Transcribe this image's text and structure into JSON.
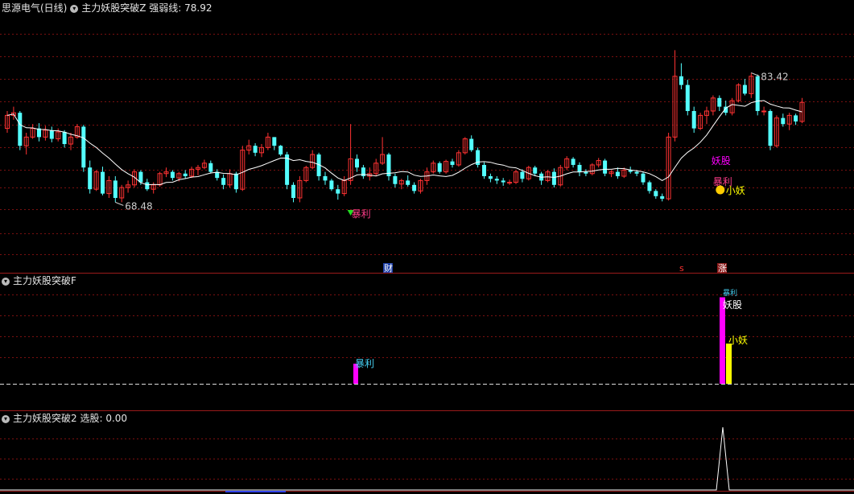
{
  "panel1": {
    "stock_name": "思源电气(日线)",
    "indicator": "主力妖股突破Z",
    "line_label": "强弱线",
    "line_value": "78.92"
  },
  "panel2": {
    "indicator": "主力妖股突破F"
  },
  "panel3": {
    "indicator": "主力妖股突破2",
    "line_label": "选股",
    "line_value": "0.00"
  },
  "colors": {
    "up": "#ff3232",
    "down": "#54ffff",
    "ma": "#ffffff",
    "grid": "#7a1010",
    "magenta": "#ff00ff",
    "yellow": "#ffff00",
    "signal_text": "#ff3d8a"
  },
  "chart_data": [
    {
      "type": "candlestick",
      "title": "思源电气(日线)",
      "ylim": [
        64,
        89
      ],
      "annotations": {
        "high": "83.42",
        "low": "68.48",
        "signal_baoli_1": "暴利",
        "signal_yaogu": "妖股",
        "signal_baoli_2": "暴利",
        "signal_xiaoyao": "小妖",
        "marker_cai": "财",
        "marker_s": "s",
        "marker_zhang": "涨"
      },
      "ohlc": [
        [
          77,
          79,
          76.5,
          78.5
        ],
        [
          78.5,
          79.5,
          78,
          78.8
        ],
        [
          78.8,
          79,
          74.5,
          75
        ],
        [
          75,
          76.5,
          74,
          76
        ],
        [
          76,
          77.5,
          75.8,
          77
        ],
        [
          77,
          77.6,
          75.5,
          76
        ],
        [
          76,
          77.3,
          75.6,
          76.8
        ],
        [
          76.8,
          77.2,
          75.4,
          75.8
        ],
        [
          75.8,
          77,
          75.5,
          76.6
        ],
        [
          76.6,
          76.8,
          74.8,
          75.2
        ],
        [
          75.2,
          76.5,
          74.5,
          76
        ],
        [
          76,
          77.5,
          75.8,
          77.2
        ],
        [
          77.2,
          77.4,
          72,
          72.5
        ],
        [
          72.5,
          73.3,
          69.5,
          70
        ],
        [
          70,
          72.2,
          69.8,
          72
        ],
        [
          72,
          72.6,
          69.3,
          69.5
        ],
        [
          69.5,
          71.5,
          69,
          71
        ],
        [
          71,
          71.5,
          68.5,
          69
        ],
        [
          69,
          70.5,
          68.5,
          70.2
        ],
        [
          70.2,
          71,
          69.6,
          70.5
        ],
        [
          70.5,
          72.3,
          70.2,
          72
        ],
        [
          72,
          72.2,
          70.5,
          70.8
        ],
        [
          70.8,
          71.2,
          69.8,
          70
        ],
        [
          70,
          70.8,
          69.5,
          70.5
        ],
        [
          70.5,
          72,
          70.3,
          71.8
        ],
        [
          71.8,
          72.5,
          71.4,
          72
        ],
        [
          72,
          72.2,
          71,
          71.3
        ],
        [
          71.3,
          72,
          70.9,
          71.8
        ],
        [
          71.8,
          72.2,
          71.2,
          71.5
        ],
        [
          71.5,
          72.6,
          71.3,
          72.3
        ],
        [
          72.3,
          72.8,
          71.6,
          72.5
        ],
        [
          72.5,
          73.4,
          72.3,
          73
        ],
        [
          73,
          73.3,
          71.8,
          72
        ],
        [
          72,
          72.3,
          71,
          71.3
        ],
        [
          71.3,
          71.7,
          70,
          70.5
        ],
        [
          70.5,
          72.3,
          70.2,
          71.8
        ],
        [
          71.8,
          72,
          69.6,
          70
        ],
        [
          70,
          75,
          69.8,
          74.5
        ],
        [
          74.5,
          75.7,
          74,
          75
        ],
        [
          75,
          75.3,
          73.8,
          74.2
        ],
        [
          74.2,
          75.2,
          73.7,
          74.8
        ],
        [
          74.8,
          76.5,
          74.5,
          76
        ],
        [
          76,
          76,
          74.5,
          75
        ],
        [
          75,
          75.1,
          73.8,
          74
        ],
        [
          74,
          74.3,
          70,
          70.5
        ],
        [
          70.5,
          70.8,
          68.5,
          69
        ],
        [
          69,
          71.5,
          68.5,
          71
        ],
        [
          71,
          72.7,
          70.8,
          72.5
        ],
        [
          72.5,
          74.5,
          72.3,
          74
        ],
        [
          74,
          74.2,
          71,
          71.5
        ],
        [
          71.5,
          72,
          70.5,
          71
        ],
        [
          71,
          71.2,
          69.8,
          70
        ],
        [
          70,
          70.5,
          68.8,
          69.5
        ],
        [
          69.5,
          71.5,
          69.2,
          71
        ],
        [
          71,
          77.5,
          70.5,
          73.5
        ],
        [
          73.5,
          74,
          72,
          72.5
        ],
        [
          72.5,
          72.8,
          71.2,
          71.5
        ],
        [
          71.5,
          72.5,
          71,
          71.8
        ],
        [
          71.8,
          73.5,
          71.5,
          73
        ],
        [
          73,
          76,
          72.8,
          74
        ],
        [
          74,
          74.2,
          71,
          71.5
        ],
        [
          71.5,
          71.8,
          70.2,
          70.6
        ],
        [
          70.6,
          71.2,
          70,
          71
        ],
        [
          71,
          71.6,
          70.3,
          70.5
        ],
        [
          70.5,
          70.8,
          69.5,
          69.8
        ],
        [
          69.8,
          71.2,
          69.5,
          71
        ],
        [
          71,
          72.5,
          70.5,
          72
        ],
        [
          72,
          73.3,
          71.8,
          73
        ],
        [
          73,
          73.2,
          71.8,
          72
        ],
        [
          72,
          73.4,
          71.8,
          73.2
        ],
        [
          73.2,
          73.5,
          72.5,
          72.8
        ],
        [
          72.8,
          74.5,
          72.6,
          74.2
        ],
        [
          74.2,
          76,
          74,
          75.8
        ],
        [
          75.8,
          76.2,
          74.3,
          74.5
        ],
        [
          74.5,
          74.8,
          72.5,
          72.8
        ],
        [
          72.8,
          73.1,
          71.2,
          71.5
        ],
        [
          71.5,
          71.8,
          70.8,
          71.2
        ],
        [
          71.2,
          71.5,
          70.6,
          71
        ],
        [
          71,
          71.3,
          70.4,
          70.8
        ],
        [
          70.8,
          71.1,
          70.5,
          70.8
        ],
        [
          70.8,
          72.2,
          70.6,
          72
        ],
        [
          72,
          72.3,
          70.8,
          71.2
        ],
        [
          71.2,
          72.7,
          71,
          72.5
        ],
        [
          72.5,
          72.7,
          71.5,
          71.8
        ],
        [
          71.8,
          72,
          70.5,
          71
        ],
        [
          71,
          72.2,
          70.8,
          72
        ],
        [
          72,
          72.4,
          70.2,
          70.5
        ],
        [
          70.5,
          72.8,
          70.3,
          72.5
        ],
        [
          72.5,
          73.8,
          72.2,
          73.5
        ],
        [
          73.5,
          73.7,
          72.5,
          72.8
        ],
        [
          72.8,
          73.1,
          71.5,
          72
        ],
        [
          72,
          72.3,
          71.5,
          71.8
        ],
        [
          71.8,
          73,
          71.6,
          72.8
        ],
        [
          72.8,
          73.6,
          72.5,
          73.3
        ],
        [
          73.3,
          73.5,
          71.5,
          71.8
        ],
        [
          71.8,
          72.2,
          71.4,
          72
        ],
        [
          72,
          72.5,
          71.2,
          71.5
        ],
        [
          71.5,
          72.5,
          71.3,
          72.2
        ],
        [
          72.2,
          72.6,
          71.8,
          72
        ],
        [
          72,
          72.2,
          71.5,
          71.8
        ],
        [
          71.8,
          72,
          70.5,
          70.8
        ],
        [
          70.8,
          71,
          69.5,
          69.8
        ],
        [
          69.8,
          70,
          68.9,
          69.2
        ],
        [
          69.2,
          69.5,
          68.6,
          68.9
        ],
        [
          68.9,
          76.5,
          68.7,
          76
        ],
        [
          76,
          86,
          75.5,
          83
        ],
        [
          83,
          84.5,
          81.5,
          82
        ],
        [
          82,
          82.6,
          78.5,
          79
        ],
        [
          79,
          79.5,
          76.5,
          77
        ],
        [
          77,
          78.8,
          76.8,
          78.5
        ],
        [
          78.5,
          79.5,
          77.5,
          79
        ],
        [
          79,
          80.8,
          78.5,
          80.5
        ],
        [
          80.5,
          80.8,
          79,
          79.5
        ],
        [
          79.5,
          80.2,
          78.5,
          78.8
        ],
        [
          78.8,
          80.5,
          78.5,
          80.2
        ],
        [
          80.2,
          82.2,
          80,
          82
        ],
        [
          82,
          82.7,
          80.8,
          81
        ],
        [
          81,
          83.4,
          80.5,
          83
        ],
        [
          83,
          83.2,
          78.5,
          79
        ],
        [
          79,
          79.5,
          78.5,
          79
        ],
        [
          79,
          79.2,
          74.5,
          75
        ],
        [
          75,
          78.5,
          74.8,
          78.2
        ],
        [
          78.2,
          78.7,
          77.2,
          77.5
        ],
        [
          77.5,
          78.8,
          76.8,
          78.5
        ],
        [
          78.5,
          78.7,
          77.4,
          77.8
        ],
        [
          77.8,
          80.5,
          77.6,
          80
        ]
      ]
    },
    {
      "type": "bar",
      "title": "主力妖股突破F",
      "ylim": [
        0,
        5
      ],
      "bars": [
        {
          "index": 46,
          "value": 1,
          "label": "暴利",
          "color": "magenta"
        },
        {
          "index": 94,
          "value": 4.3,
          "label": "暴利",
          "color": "magenta"
        },
        {
          "index": 95,
          "value": 2,
          "label": "小妖",
          "color": "yellow"
        }
      ],
      "bar_top_label": "妖股"
    },
    {
      "type": "line",
      "title": "主力妖股突破2",
      "ylim": [
        0,
        1
      ],
      "values_nonzero": [
        {
          "index": 94,
          "value": 1
        }
      ]
    }
  ]
}
